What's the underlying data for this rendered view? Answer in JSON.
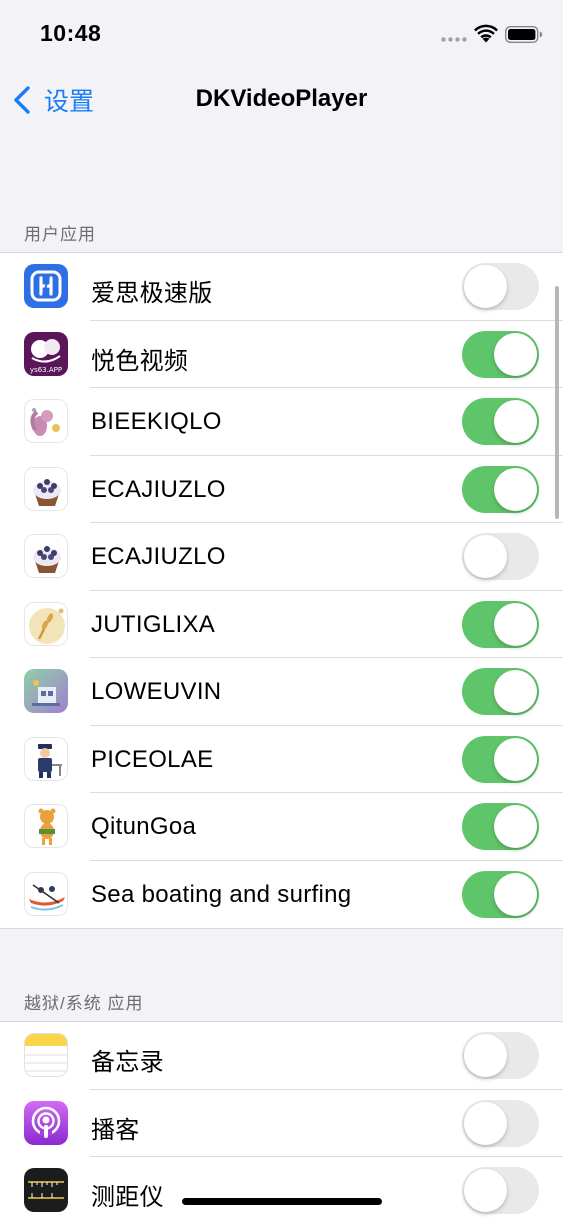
{
  "status_bar": {
    "time": "10:48"
  },
  "nav": {
    "back_label": "设置",
    "title": "DKVideoPlayer"
  },
  "sections": [
    {
      "header": "用户应用",
      "rows": [
        {
          "name": "爱思极速版",
          "icon": "aisi-app-icon",
          "enabled": false
        },
        {
          "name": "悦色视频",
          "icon": "yuese-video-app-icon",
          "icon_text": "ys63.APP",
          "enabled": true
        },
        {
          "name": "BIEEKIQLO",
          "icon": "squirrel-app-icon",
          "enabled": true
        },
        {
          "name": "ECAJIUZLO",
          "icon": "cupcake-app-icon",
          "enabled": true
        },
        {
          "name": "ECAJIUZLO",
          "icon": "cupcake-app-icon",
          "enabled": false
        },
        {
          "name": "JUTIGLIXA",
          "icon": "wheat-app-icon",
          "enabled": true
        },
        {
          "name": "LOWEUVIN",
          "icon": "factory-app-icon",
          "enabled": true
        },
        {
          "name": "PICEOLAE",
          "icon": "police-officer-app-icon",
          "enabled": true
        },
        {
          "name": "QitunGoa",
          "icon": "tiger-app-icon",
          "enabled": true
        },
        {
          "name": "Sea boating and surfing",
          "icon": "kayak-app-icon",
          "enabled": true
        }
      ]
    },
    {
      "header": "越狱/系统 应用",
      "rows": [
        {
          "name": "备忘录",
          "icon": "notes-app-icon",
          "enabled": false
        },
        {
          "name": "播客",
          "icon": "podcasts-app-icon",
          "enabled": false
        },
        {
          "name": "测距仪",
          "icon": "measure-app-icon",
          "enabled": false
        }
      ]
    }
  ],
  "colors": {
    "accent": "#1a7cf6",
    "toggle_on": "#5fc56a",
    "toggle_off": "#e9e9ea",
    "background": "#f2f2f7"
  }
}
